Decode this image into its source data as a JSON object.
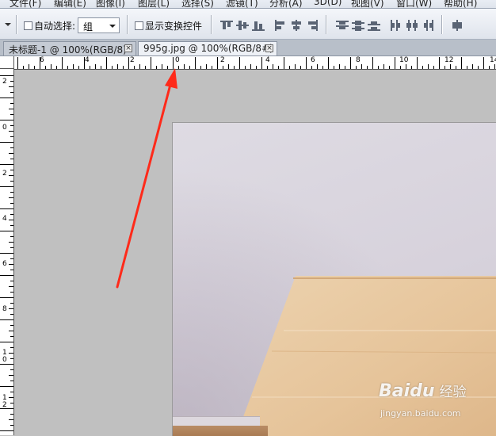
{
  "menu": {
    "items": [
      "文件(F)",
      "编辑(E)",
      "图像(I)",
      "图层(L)",
      "选择(S)",
      "滤镜(T)",
      "分析(A)",
      "3D(D)",
      "视图(V)",
      "窗口(W)",
      "帮助(H)"
    ]
  },
  "options_bar": {
    "auto_select_label": "自动选择:",
    "auto_select_value": "组",
    "show_transform_label": "显示变换控件",
    "align_icons": [
      "align-top-icon",
      "align-vcenter-icon",
      "align-bottom-icon",
      "align-left-icon",
      "align-hcenter-icon",
      "align-right-icon",
      "distribute-top-icon",
      "distribute-vcenter-icon",
      "distribute-bottom-icon",
      "distribute-left-icon",
      "distribute-hcenter-icon",
      "distribute-right-icon",
      "auto-align-icon"
    ]
  },
  "tabs": [
    {
      "label": "未标题-1 @ 100%(RGB/8)",
      "active": false
    },
    {
      "label": "995g.jpg @ 100%(RGB/8#)",
      "active": true
    }
  ],
  "ruler_top": {
    "labels": [
      "6",
      "4",
      "2",
      "0",
      "2",
      "4",
      "6",
      "8",
      "10",
      "12",
      "14"
    ]
  },
  "ruler_left": {
    "labels": [
      "2",
      "0",
      "2",
      "4",
      "6",
      "8",
      "10",
      "12"
    ]
  },
  "watermark": {
    "logo": "Baidu",
    "brand": "经验",
    "url": "jingyan.baidu.com"
  },
  "colors": {
    "arrow": "#ff2a1a",
    "canvas_bg": "#c0c0c0",
    "table_wood": "#e8c9a2"
  }
}
